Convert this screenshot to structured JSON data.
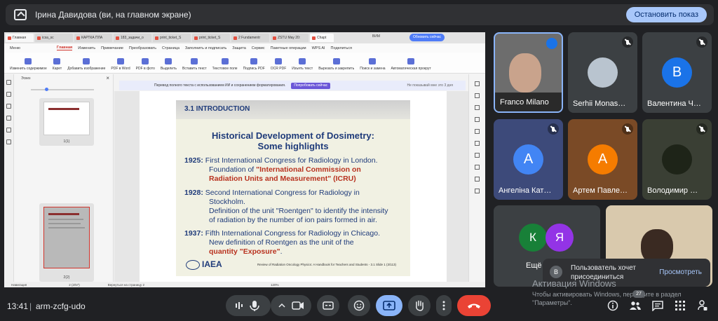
{
  "banner": {
    "title": "Ірина Давидова (ви, на главном экране)",
    "stop_label": "Остановить показ"
  },
  "pdf_viewer": {
    "tabs": [
      "Главная",
      "icsa_sc",
      "КАРТКА ПЛА",
      "183_задачи_о",
      "print_ticket_S",
      "print_ticket_S",
      "2 Fundamentr",
      "ZSTU May 20:",
      "Chapt"
    ],
    "badge": "ВИМ",
    "update_label": "Обновить сейчас",
    "menu": [
      "Меню",
      "Главная",
      "Изменить",
      "Примечание",
      "Преобразовать",
      "Страница",
      "Заполнить и подписать",
      "Защита",
      "Сервис",
      "Пакетные операции",
      "WPS AI",
      "Поделиться"
    ],
    "ribbon": [
      "Изменить содержимое",
      "Карет",
      "Добавить изображение",
      "PDF в Word",
      "PDF в фото",
      "Выделить",
      "Вставить текст",
      "Текстовое поле",
      "Подпись PDF",
      "OCR PDF",
      "Изъять текст",
      "Вырезать и закрепить",
      "Поиск и замена",
      "Автоматическая прокрут"
    ],
    "sidebar_title": "Эскиз",
    "thumb_labels": [
      "1(1)",
      "2(2)"
    ],
    "translate_text": "Перевод полного текста с использованием ИИ и сохранением форматирования.",
    "translate_button": "Попробовать сейчас",
    "translate_skip": "Не показывай мне это 3 дня",
    "status": [
      "Навигация",
      "2 (2/57)",
      "Вернуться на страницу 2",
      "120%"
    ]
  },
  "slide": {
    "section": "3.1  INTRODUCTION",
    "heading_line1": "Historical Development of Dosimetry:",
    "heading_line2": "Some highlights",
    "y1925": "1925:",
    "t1925a": "First International Congress for Radiology in London.",
    "t1925b": "Foundation of ",
    "t1925c": "\"International Commission on",
    "t1925d": "Radiation Units and Measurement\" (ICRU)",
    "y1928": "1928:",
    "t1928a": "Second International Congress for Radiology in",
    "t1928b": "Stockholm.",
    "t1928c": "Definition of the unit \"Roentgen\" to identify the intensity",
    "t1928d": "of radiation by the number of ion pairs formed in air.",
    "y1937": "1937:",
    "t1937a": "Fifth International Congress for Radiology in Chicago.",
    "t1937b": "New definition of Roentgen as the unit of the",
    "t1937c": "quantity \"Exposure\"",
    "t1937d": ".",
    "logo": "IAEA",
    "caption": "Review of Radiation Oncology Physics: A Handbook for Teachers and Students - 3.1 Slide 1 (3/113)"
  },
  "participants": [
    {
      "name": "Franco Milano",
      "letter": "",
      "color": "#5a5a5a"
    },
    {
      "name": "Serhii Monas…",
      "letter": "",
      "color": "#5e6670"
    },
    {
      "name": "Валентина Ч…",
      "letter": "В",
      "color": "#1a73e8"
    },
    {
      "name": "Ангеліна Кат…",
      "letter": "А",
      "color": "#4285f4"
    },
    {
      "name": "Артем Павле…",
      "letter": "А",
      "color": "#f57c00"
    },
    {
      "name": "Володимир …",
      "letter": "",
      "color": "#3a4a3a"
    },
    {
      "name": "Ещё",
      "letter": "К",
      "letter2": "Я",
      "color": "#188038",
      "color2": "#9334e6"
    }
  ],
  "notification": {
    "icon_letter": "В",
    "message": "Пользователь хочет присоединиться",
    "link": "Просмотреть"
  },
  "watermark": {
    "title": "Активация Windows",
    "text": "Чтобы активировать Windows, перейдите в раздел \"Параметры\"."
  },
  "bottom": {
    "time": "13:41",
    "separator": "|",
    "meeting_code": "arm-zcfg-udo",
    "participant_count": "27"
  },
  "colors": {
    "background": "#202124",
    "present_active": "#8ab4f8",
    "end_call": "#ea4335",
    "slide_blue": "#1f3b7a",
    "slide_red": "#b8321f"
  }
}
